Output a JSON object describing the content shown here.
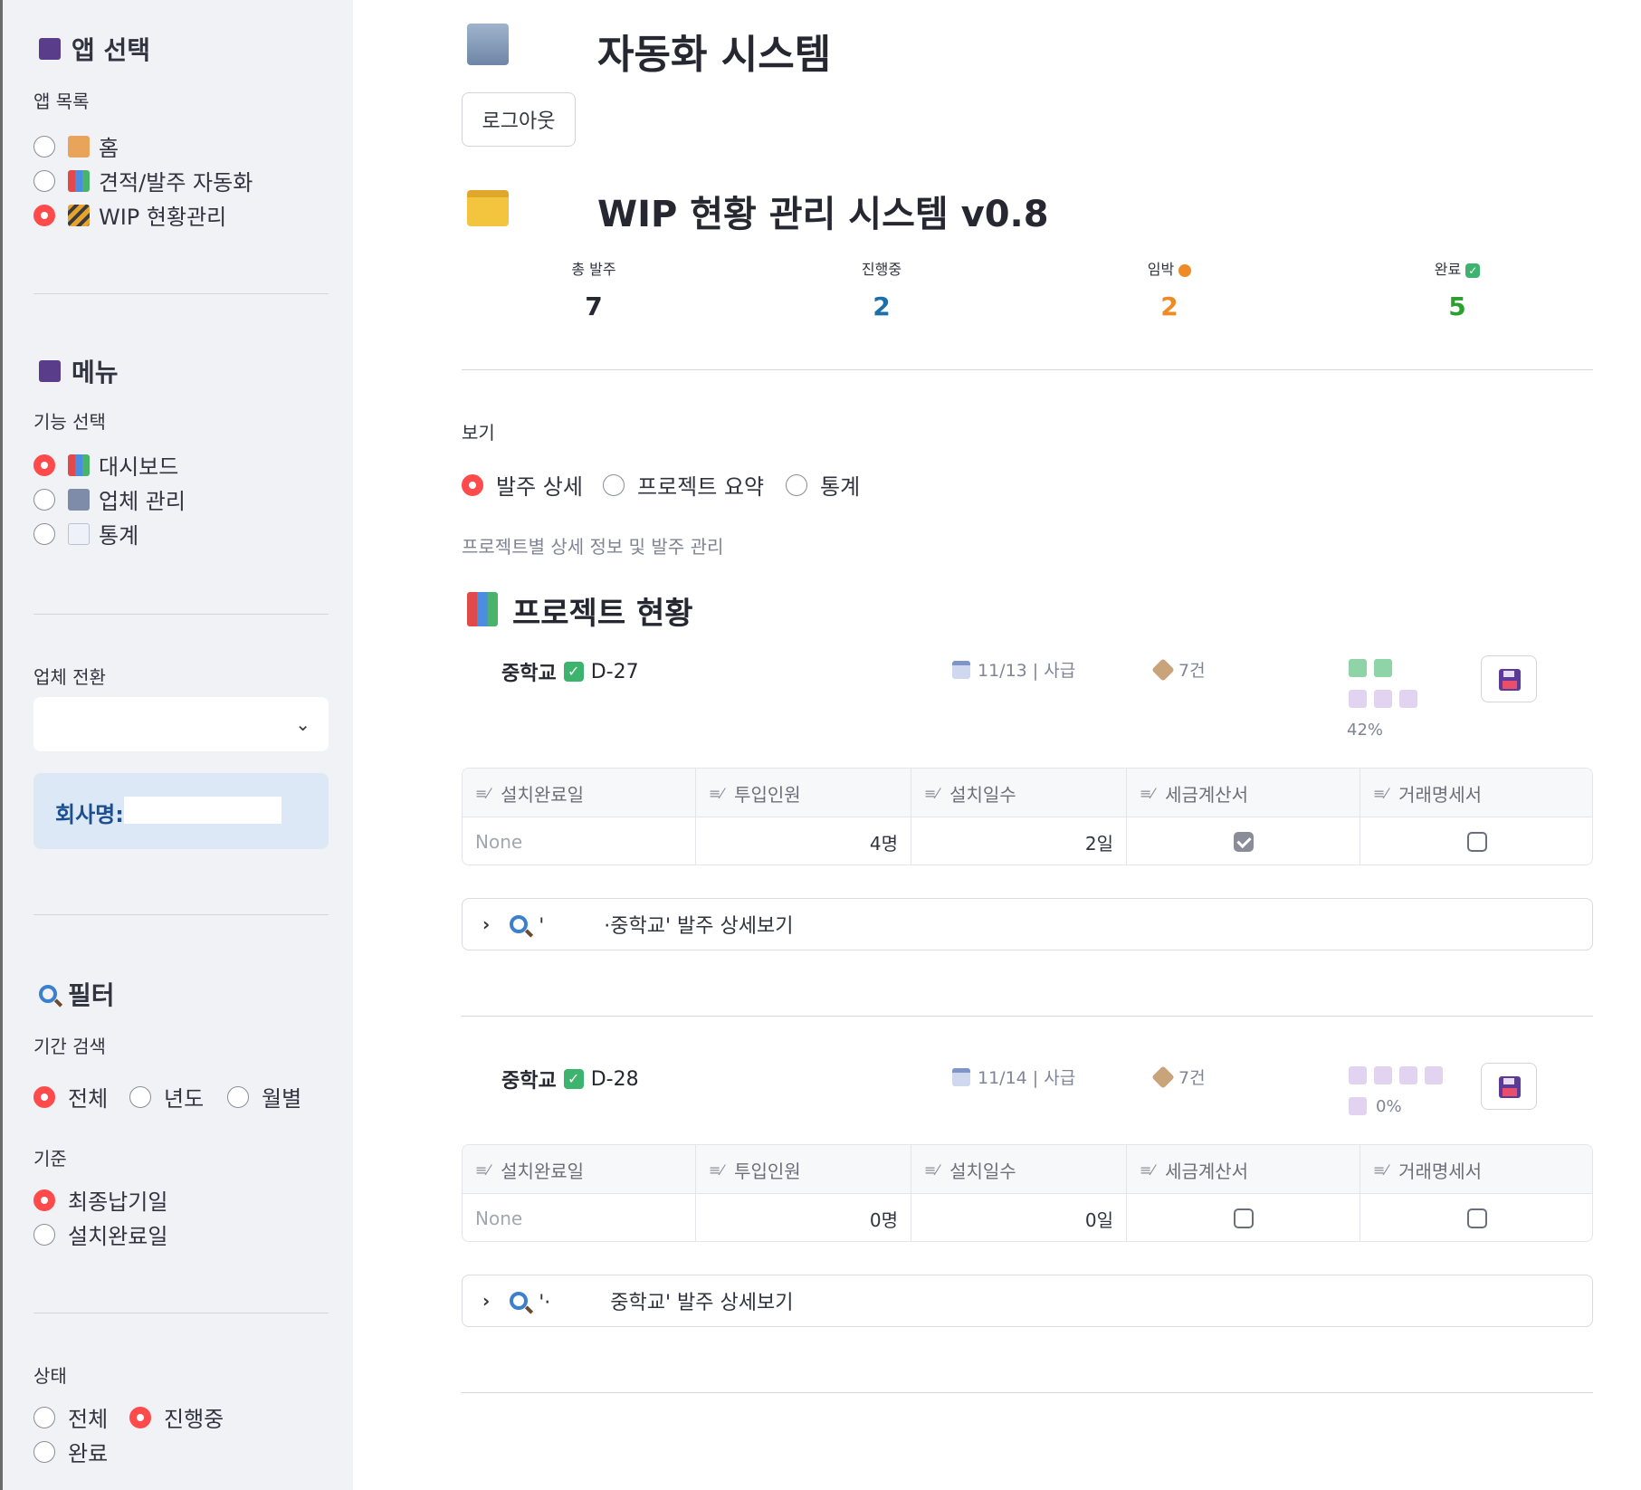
{
  "sidebar": {
    "app_select": {
      "heading": "앱 선택",
      "label": "앱 목록",
      "options": [
        {
          "label": "홈",
          "selected": false,
          "icon": "house-icon"
        },
        {
          "label": "견적/발주 자동화",
          "selected": false,
          "icon": "bar-chart-icon"
        },
        {
          "label": "WIP 현황관리",
          "selected": true,
          "icon": "construction-icon"
        }
      ]
    },
    "menu": {
      "heading": "메뉴",
      "label": "기능 선택",
      "options": [
        {
          "label": "대시보드",
          "selected": true,
          "icon": "bar-chart-icon"
        },
        {
          "label": "업체 관리",
          "selected": false,
          "icon": "building-icon"
        },
        {
          "label": "통계",
          "selected": false,
          "icon": "line-chart-icon"
        }
      ]
    },
    "company_switch": {
      "label": "업체 전환",
      "value": ""
    },
    "company_info": {
      "label": "회사명:",
      "value": ""
    },
    "filter": {
      "heading": "필터",
      "period_label": "기간 검색",
      "period_options": [
        {
          "label": "전체",
          "selected": true
        },
        {
          "label": "년도",
          "selected": false
        },
        {
          "label": "월별",
          "selected": false
        }
      ],
      "basis_label": "기준",
      "basis_options": [
        {
          "label": "최종납기일",
          "selected": true
        },
        {
          "label": "설치완료일",
          "selected": false
        }
      ],
      "status_label": "상태",
      "status_options": [
        {
          "label": "전체",
          "selected": false
        },
        {
          "label": "진행중",
          "selected": true
        },
        {
          "label": "완료",
          "selected": false
        }
      ]
    }
  },
  "main": {
    "app_title": "자동화 시스템",
    "logout_label": "로그아웃",
    "system_title": "WIP 현황 관리 시스템 v0.8",
    "metrics": [
      {
        "label": "총 발주",
        "value": "7",
        "color": "#262730"
      },
      {
        "label": "진행중",
        "value": "2",
        "color": "#1c6fa8"
      },
      {
        "label": "임박",
        "value": "2",
        "color": "#f08a24",
        "icon": "orange-circle-icon"
      },
      {
        "label": "완료",
        "value": "5",
        "color": "#2ca02c",
        "icon": "check-icon"
      }
    ],
    "view": {
      "label": "보기",
      "options": [
        {
          "label": "발주 상세",
          "selected": true
        },
        {
          "label": "프로젝트 요약",
          "selected": false
        },
        {
          "label": "통계",
          "selected": false
        }
      ],
      "caption": "프로젝트별 상세 정보 및 발주 관리"
    },
    "section_title": "프로젝트 현황",
    "table_headers": [
      "설치완료일",
      "투입인원",
      "설치일수",
      "세금계산서",
      "거래명세서"
    ],
    "projects": [
      {
        "name": "중학교",
        "dday": "D-27",
        "date": "11/13 | 사급",
        "count": "7건",
        "progress_fraction": 0.42,
        "progress_text": "42%",
        "row": {
          "install_date": "None",
          "staff": "4명",
          "days": "2일",
          "tax_invoice": true,
          "statement": false
        },
        "expander": "'　　　·중학교' 발주 상세보기"
      },
      {
        "name": "중학교",
        "dday": "D-28",
        "date": "11/14 | 사급",
        "count": "7건",
        "progress_fraction": 0.0,
        "progress_text": "0%",
        "row": {
          "install_date": "None",
          "staff": "0명",
          "days": "0일",
          "tax_invoice": false,
          "statement": false
        },
        "expander": "'·　　　중학교' 발주 상세보기"
      }
    ]
  }
}
